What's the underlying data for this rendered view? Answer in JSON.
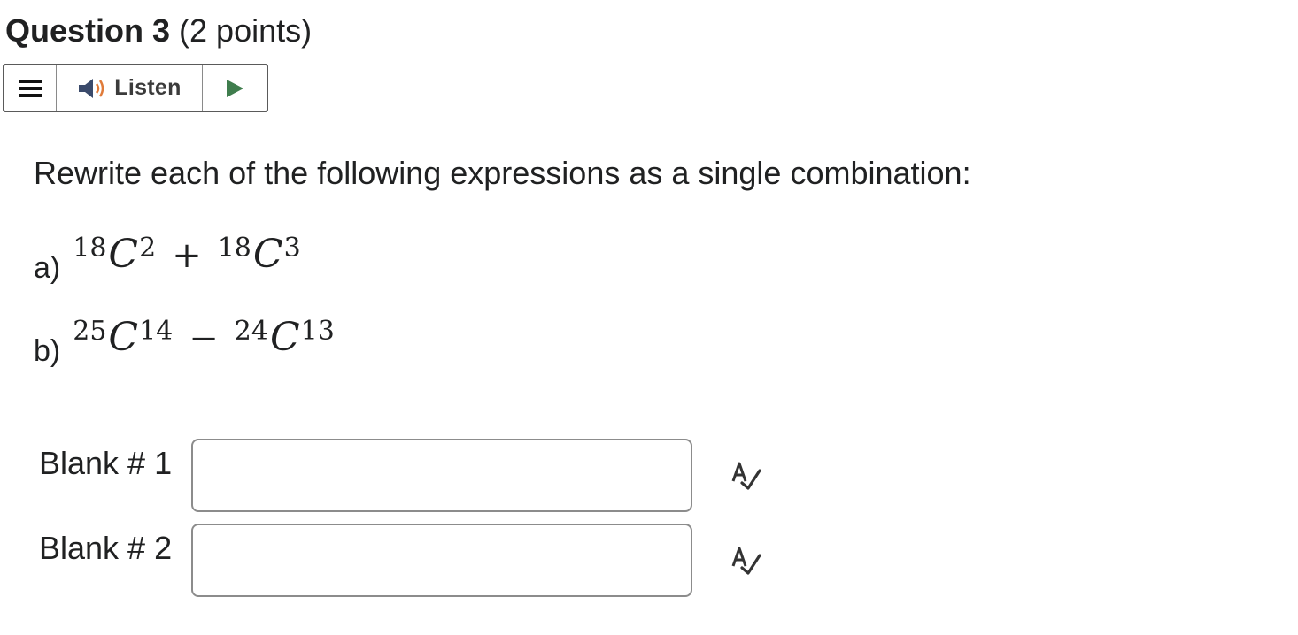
{
  "question": {
    "title": "Question 3",
    "points": "(2 points)"
  },
  "toolbar": {
    "menu_icon": "menu-icon",
    "speaker_icon": "speaker-icon",
    "listen_label": "Listen",
    "play_icon": "play-icon",
    "colors": {
      "play": "#3f7d4d",
      "speaker_body": "#3a4a6b",
      "speaker_waves": "#e07b3a"
    }
  },
  "prompt": "Rewrite each of the following expressions as a single combination:",
  "parts": [
    {
      "label": "a)",
      "term1": {
        "n": "18",
        "sym": "C",
        "r": "2"
      },
      "operator": "+",
      "term2": {
        "n": "18",
        "sym": "C",
        "r": "3"
      }
    },
    {
      "label": "b)",
      "term1": {
        "n": "25",
        "sym": "C",
        "r": "14"
      },
      "operator": "−",
      "term2": {
        "n": "24",
        "sym": "C",
        "r": "13"
      }
    }
  ],
  "blanks": [
    {
      "label": "Blank # 1",
      "value": "",
      "placeholder": "",
      "icon": "spellcheck-icon"
    },
    {
      "label": "Blank # 2",
      "value": "",
      "placeholder": "",
      "icon": "spellcheck-icon"
    }
  ]
}
